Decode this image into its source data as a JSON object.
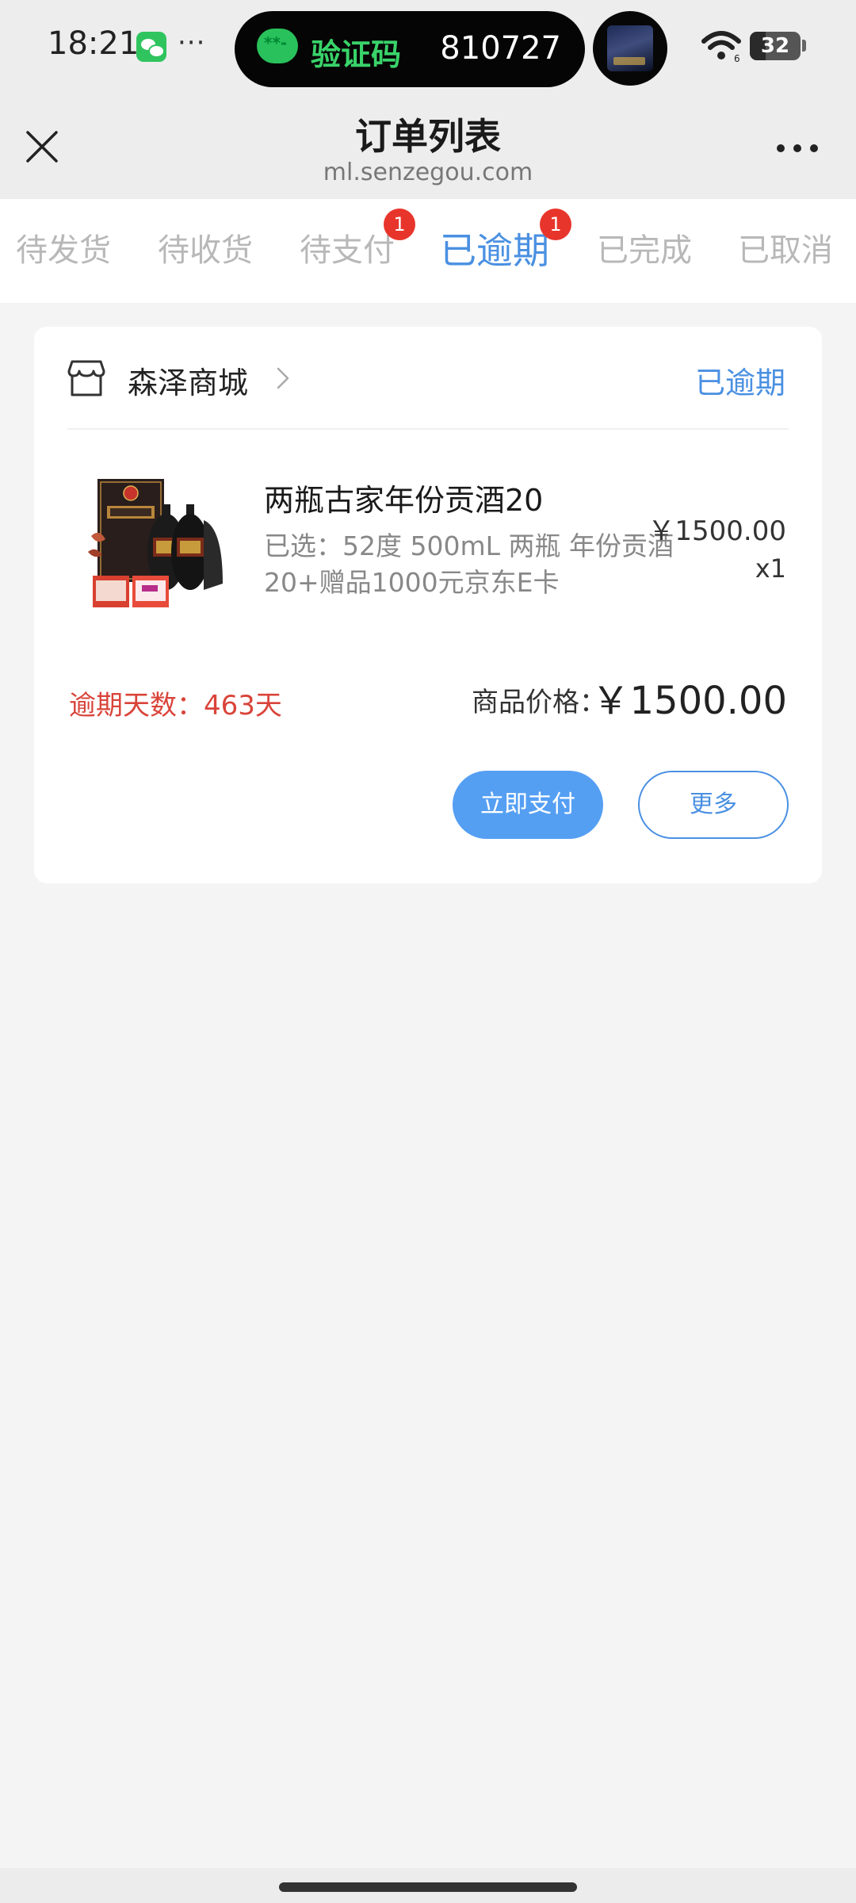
{
  "status_bar": {
    "time": "18:21",
    "more_dots": "···",
    "notification_label": "验证码",
    "notification_code": "810727",
    "battery_level": "32",
    "battery_fraction": 0.32
  },
  "title_bar": {
    "title": "订单列表",
    "url": "ml.senzegou.com"
  },
  "tabs": [
    {
      "label": "待发货",
      "badge": ""
    },
    {
      "label": "待收货",
      "badge": ""
    },
    {
      "label": "待支付",
      "badge": "1"
    },
    {
      "label": "已逾期",
      "badge": "1",
      "active": true
    },
    {
      "label": "已完成",
      "badge": ""
    },
    {
      "label": "已取消",
      "badge": ""
    }
  ],
  "order": {
    "shop_name": "森泽商城",
    "status": "已逾期",
    "product_name": "两瓶古家年份贡酒20",
    "product_spec": "已选：52度 500mL 两瓶 年份贡酒20+赠品1000元京东E卡",
    "unit_price": "￥1500.00",
    "quantity": "x1",
    "overdue_days": "逾期天数：463天",
    "total_label": "商品价格：",
    "total_value": "￥1500.00",
    "pay_button": "立即支付",
    "more_button": "更多"
  },
  "colors": {
    "accent": "#4a90e2",
    "pay_button": "#559ff3",
    "overdue_red": "#d9443a",
    "badge_red": "#e8352b",
    "notification_green": "#39d36a"
  }
}
